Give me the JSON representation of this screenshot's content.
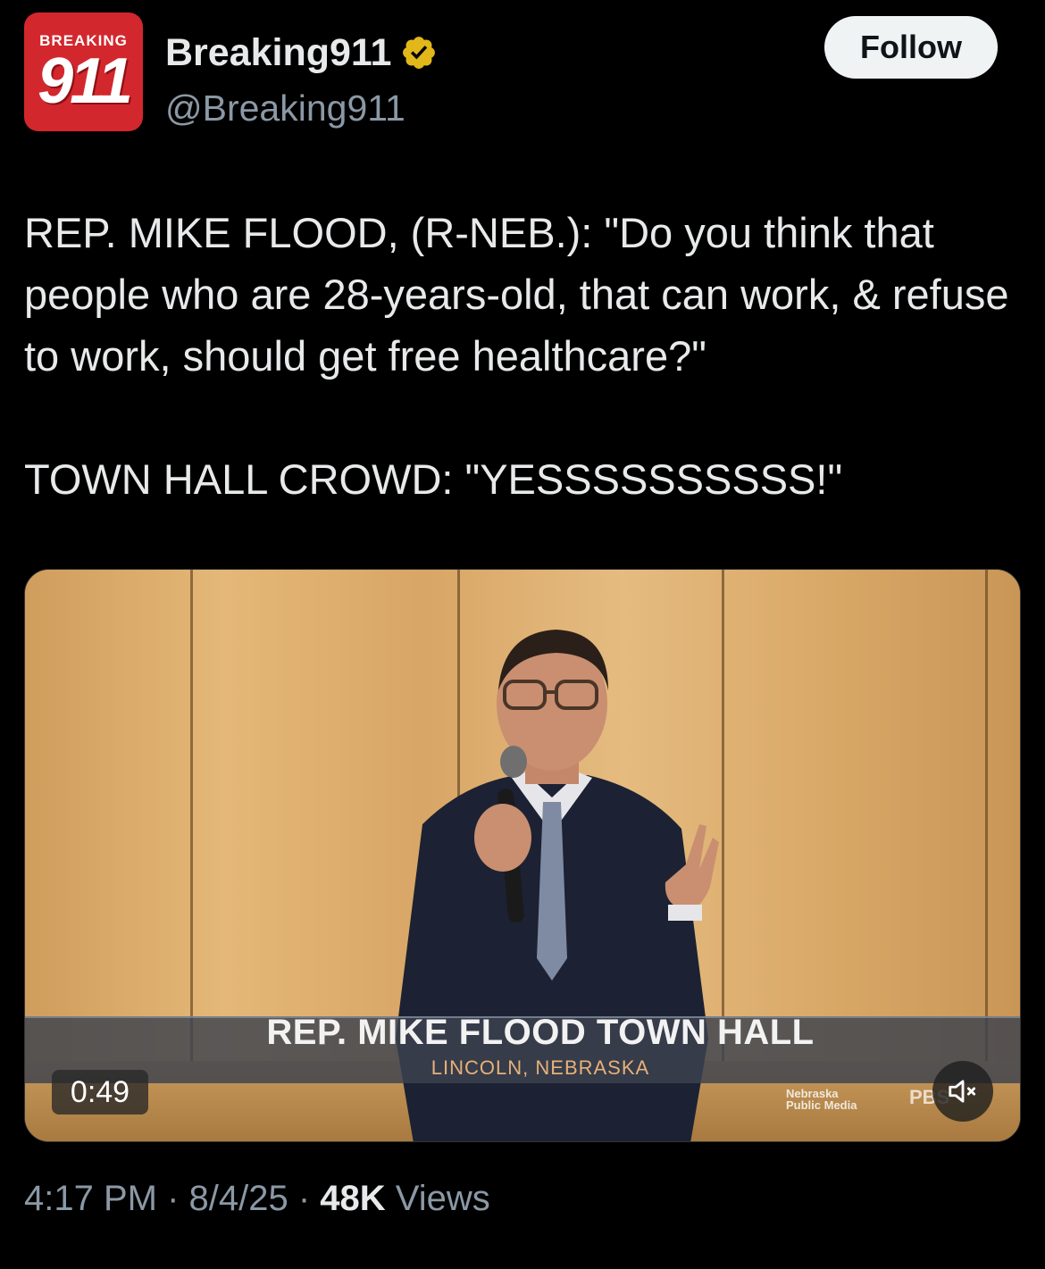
{
  "account": {
    "avatar_top_text": "BREAKING",
    "avatar_number": "911",
    "display_name": "Breaking911",
    "handle": "@Breaking911",
    "verified_icon": "verified-badge-gold",
    "follow_label": "Follow"
  },
  "tweet": {
    "text": "REP. MIKE FLOOD, (R-NEB.): \"Do you think that people who are 28-years-old, that can work, & refuse to work, should get free healthcare?\"\n\nTOWN HALL CROWD: \"YESSSSSSSSSS!\""
  },
  "video": {
    "banner_title": "REP. MIKE FLOOD TOWN HALL",
    "banner_subtitle": "LINCOLN, NEBRASKA",
    "duration": "0:49",
    "mute_icon": "speaker-muted-icon",
    "watermark_npm_line1": "Nebraska",
    "watermark_npm_line2": "Public Media",
    "watermark_pbs": "PBS"
  },
  "meta": {
    "time": "4:17 PM",
    "separator": " · ",
    "date": "8/4/25",
    "views_count": "48K",
    "views_label": " Views"
  },
  "colors": {
    "background": "#000000",
    "text_primary": "#e7e9ea",
    "text_secondary": "#8b98a5",
    "verified_gold": "#e2b719",
    "avatar_red": "#d3272e"
  }
}
